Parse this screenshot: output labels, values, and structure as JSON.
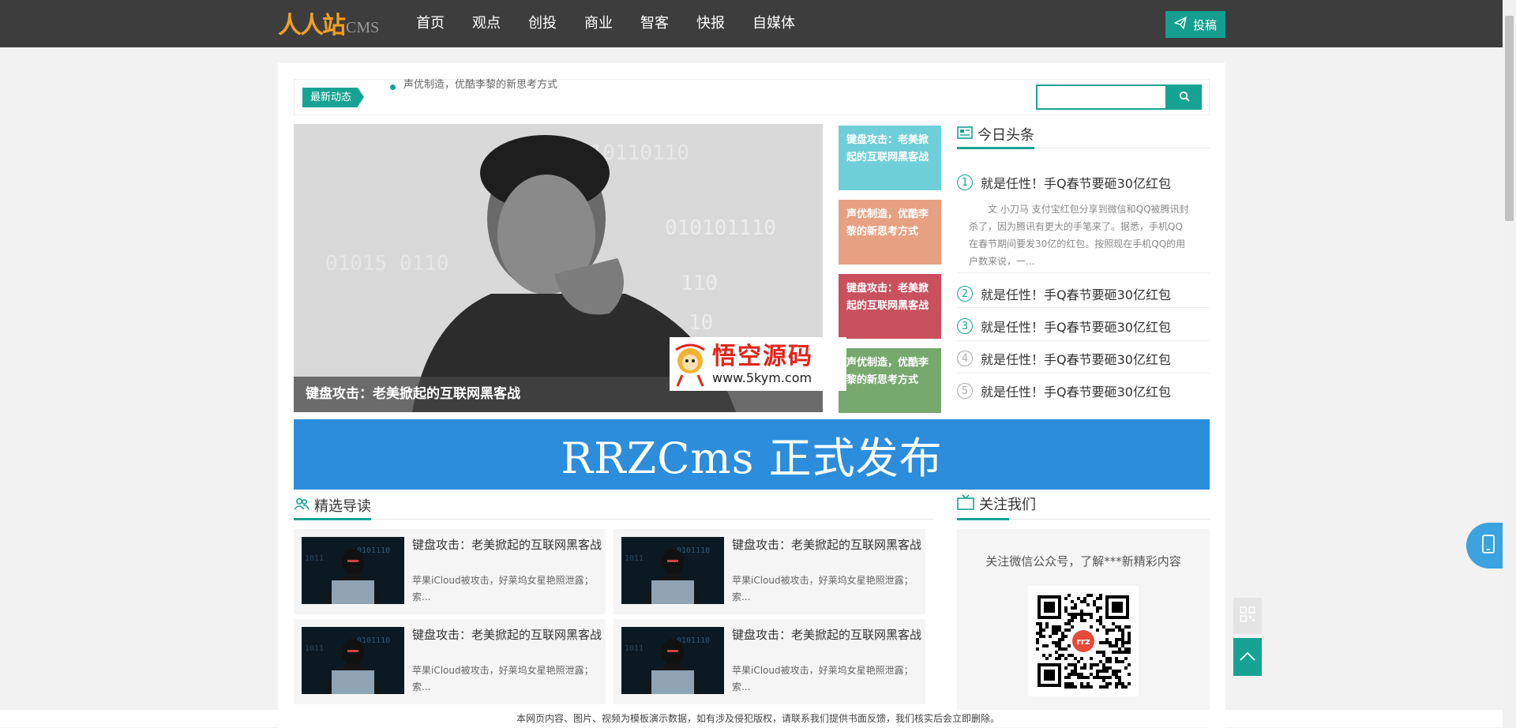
{
  "header": {
    "logo_main": "人人站",
    "logo_sub": "CMS",
    "nav": [
      "首页",
      "观点",
      "创投",
      "商业",
      "智客",
      "快报",
      "自媒体"
    ],
    "contribute_label": "投稿"
  },
  "ticker": {
    "label": "最新动态",
    "text": "声优制造，优酷李黎的新思考方式"
  },
  "search": {
    "placeholder": ""
  },
  "hero": {
    "caption": "键盘攻击：老美掀起的互联网黑客战"
  },
  "tiles": [
    {
      "title": "键盘攻击：老美掀起的互联网黑客战",
      "color": "#6fcfd8"
    },
    {
      "title": "声优制造，优酷李黎的新思考方式",
      "color": "#e6a183"
    },
    {
      "title": "键盘攻击：老美掀起的互联网黑客战",
      "color": "#c9505d"
    },
    {
      "title": "声优制造，优酷李黎的新思考方式",
      "color": "#77a86e"
    }
  ],
  "today": {
    "title": "今日头条",
    "items": [
      {
        "num": "1",
        "title": "就是任性！手Q春节要砸30亿红包"
      },
      {
        "num": "2",
        "title": "就是任性！手Q春节要砸30亿红包"
      },
      {
        "num": "3",
        "title": "就是任性！手Q春节要砸30亿红包"
      },
      {
        "num": "4",
        "title": "就是任性！手Q春节要砸30亿红包"
      },
      {
        "num": "5",
        "title": "就是任性！手Q春节要砸30亿红包"
      }
    ],
    "first_desc": "文 小刀马 支付宝红包分享到微信和QQ被腾讯封杀了，因为腾讯有更大的手笔来了。据悉，手机QQ在春节期间要发30亿的红包。按照现在手机QQ的用户数来说，一..."
  },
  "banner": {
    "text": "RRZCms 正式发布"
  },
  "featured": {
    "title": "精选导读",
    "items": [
      {
        "title": "键盘攻击：老美掀起的互联网黑客战",
        "desc": "苹果iCloud被攻击，好莱坞女星艳照泄露；索..."
      },
      {
        "title": "键盘攻击：老美掀起的互联网黑客战",
        "desc": "苹果iCloud被攻击，好莱坞女星艳照泄露；索..."
      },
      {
        "title": "键盘攻击：老美掀起的互联网黑客战",
        "desc": "苹果iCloud被攻击，好莱坞女星艳照泄露；索..."
      },
      {
        "title": "键盘攻击：老美掀起的互联网黑客战",
        "desc": "苹果iCloud被攻击，好莱坞女星艳照泄露；索..."
      }
    ]
  },
  "follow": {
    "title": "关注我们",
    "text": "关注微信公众号，了解***新精彩内容",
    "qr_badge": "rrz"
  },
  "watermark": {
    "title": "悟空源码",
    "url": "www.5kym.com"
  },
  "footer": {
    "note": "本网页内容、图片、视频为模板演示数据，如有涉及侵犯版权，请联系我们提供书面反馈，我们核实后会立即删除。"
  },
  "colors": {
    "accent": "#16a393",
    "header_bg": "#3d3d3d",
    "banner": "#2b8ddb"
  },
  "icons": {
    "contribute": "paper-plane-icon",
    "search": "search-icon",
    "today": "newspaper-icon",
    "featured": "users-icon",
    "follow": "tv-icon",
    "phone": "phone-icon",
    "qr": "qr-code-icon",
    "back_to_top": "chevron-up-icon"
  }
}
